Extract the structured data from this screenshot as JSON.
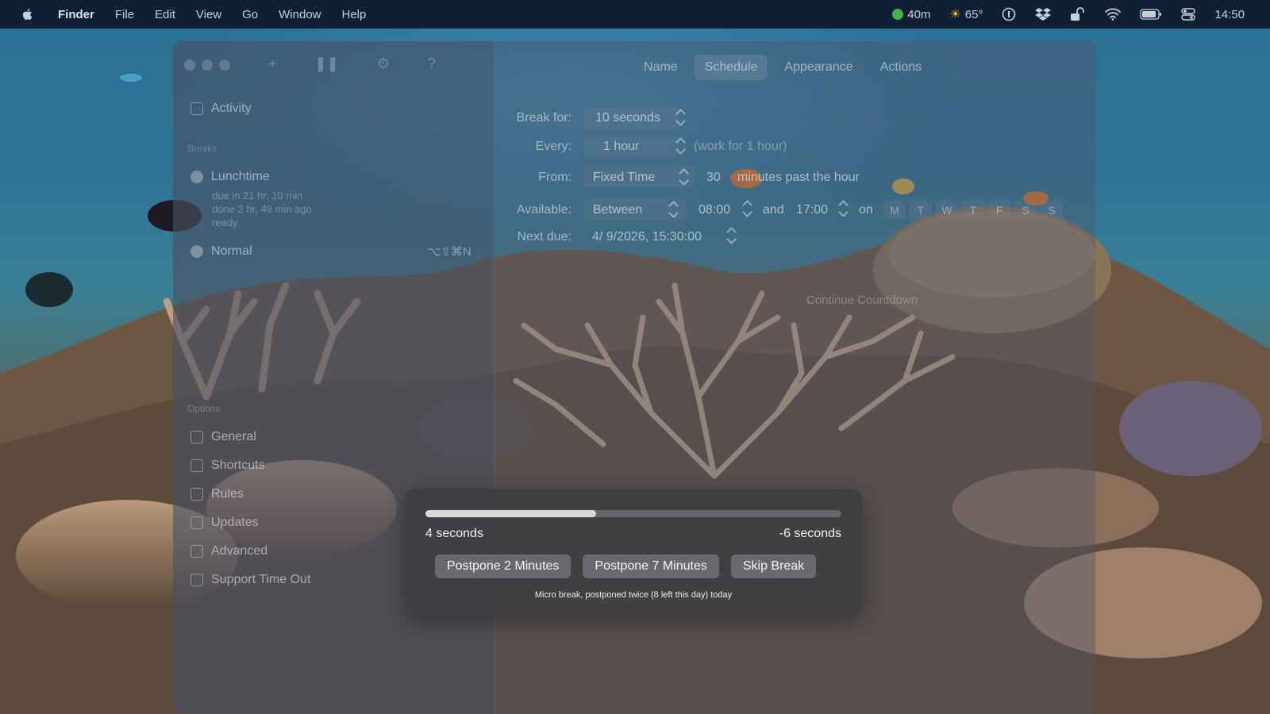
{
  "menubar": {
    "app": "Finder",
    "menus": [
      "File",
      "Edit",
      "View",
      "Go",
      "Window",
      "Help"
    ],
    "status": {
      "timer": "40m",
      "weather": "65°",
      "clock": "14:50"
    }
  },
  "sidebar": {
    "activity": "Activity",
    "breaks_header": "Breaks",
    "breaks": [
      {
        "name": "Lunchtime",
        "lines": [
          "due in 21 hr, 10 min",
          "done 2 hr, 49 min ago",
          "ready"
        ]
      },
      {
        "name": "Normal",
        "shortcut": "⌥⇧⌘N"
      }
    ],
    "options_header": "Options",
    "options": [
      "General",
      "Shortcuts",
      "Rules",
      "Updates",
      "Advanced",
      "Support Time Out"
    ]
  },
  "tabs": [
    "Name",
    "Schedule",
    "Appearance",
    "Actions"
  ],
  "schedule": {
    "break_for_label": "Break for:",
    "break_for_value": "10 seconds",
    "every_label": "Every:",
    "every_value": "1 hour",
    "every_hint": "(work for 1 hour)",
    "from_label": "From:",
    "from_value": "Fixed Time",
    "from_minutes": "30",
    "from_suffix": "minutes past the hour",
    "available_label": "Available:",
    "available_mode": "Between",
    "available_start": "08:00",
    "available_and": "and",
    "available_end": "17:00",
    "available_on": "on",
    "days": [
      "M",
      "T",
      "W",
      "T",
      "F",
      "S",
      "S"
    ],
    "next_due_label": "Next due:",
    "next_due_value": "4/ 9/2026, 15:30:00",
    "continue_countdown": "Continue Countdown"
  },
  "overlay": {
    "progress": 0.41,
    "elapsed": "4 seconds",
    "remaining": "-6 seconds",
    "buttons": {
      "postpone2": "Postpone 2 Minutes",
      "postpone7": "Postpone 7 Minutes",
      "skip": "Skip Break"
    },
    "status": "Micro break, postponed twice (8 left this day) today"
  }
}
